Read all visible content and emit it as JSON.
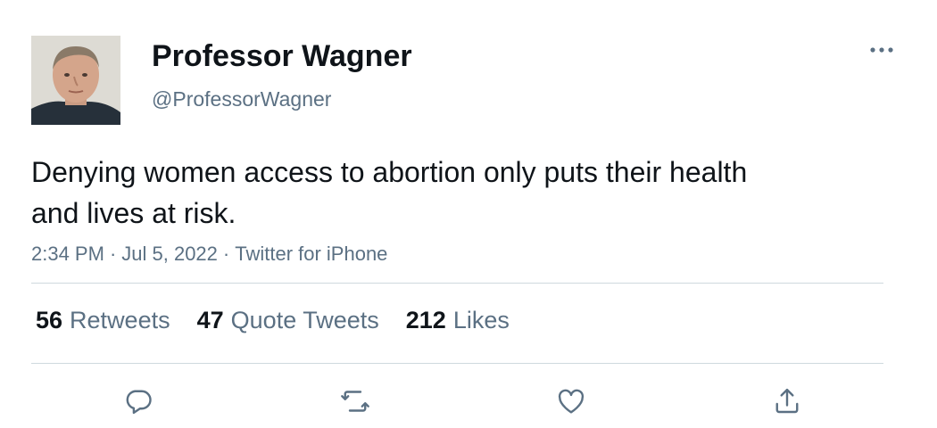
{
  "author": {
    "display_name": "Professor Wagner",
    "handle": "@ProfessorWagner",
    "avatar_icon": "user-avatar-photo"
  },
  "tweet": {
    "text": "Denying women access to abortion only puts their health and lives at risk.",
    "time": "2:34 PM",
    "date": "Jul 5, 2022",
    "source": "Twitter for iPhone",
    "separator": "·"
  },
  "stats": {
    "retweets_count": "56",
    "retweets_label": "Retweets",
    "quotes_count": "47",
    "quotes_label": "Quote Tweets",
    "likes_count": "212",
    "likes_label": "Likes"
  },
  "actions": {
    "reply_icon": "reply-icon",
    "retweet_icon": "retweet-icon",
    "like_icon": "heart-icon",
    "share_icon": "share-icon",
    "more_icon": "more-icon"
  },
  "colors": {
    "text_primary": "#0f1419",
    "text_secondary": "#5b7083",
    "divider": "#cfd9de"
  }
}
